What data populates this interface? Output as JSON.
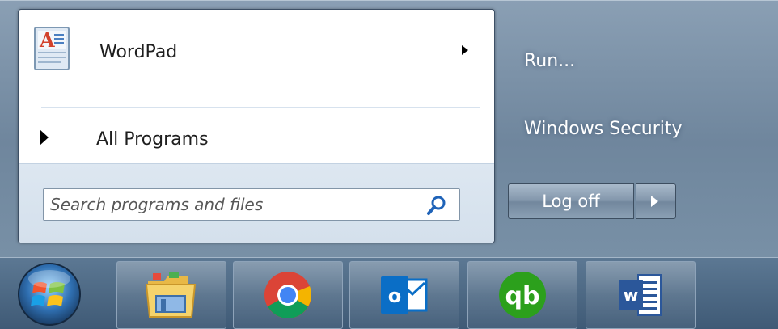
{
  "start_menu": {
    "pinned": [
      {
        "label": "WordPad",
        "icon": "wordpad-icon",
        "has_submenu": true
      }
    ],
    "all_programs_label": "All Programs",
    "search": {
      "placeholder": "Search programs and files",
      "value": ""
    },
    "right_column": {
      "run_label": "Run...",
      "windows_security_label": "Windows Security",
      "log_off_label": "Log off"
    }
  },
  "taskbar": {
    "items": [
      {
        "name": "start-orb",
        "icon": "windows-start-orb-icon"
      },
      {
        "name": "file-explorer",
        "icon": "folder-icon"
      },
      {
        "name": "chrome",
        "icon": "chrome-icon"
      },
      {
        "name": "outlook",
        "icon": "outlook-icon",
        "glyph": "o"
      },
      {
        "name": "quickbooks",
        "icon": "quickbooks-icon",
        "glyph": "qb"
      },
      {
        "name": "word",
        "icon": "word-icon",
        "glyph": "w"
      }
    ]
  },
  "colors": {
    "taskbar": "#3f5a76",
    "menu_right_panel": "#7890a6",
    "outlook_blue": "#0a6ec6",
    "quickbooks_green": "#2ca01c",
    "word_blue": "#2b579a"
  }
}
